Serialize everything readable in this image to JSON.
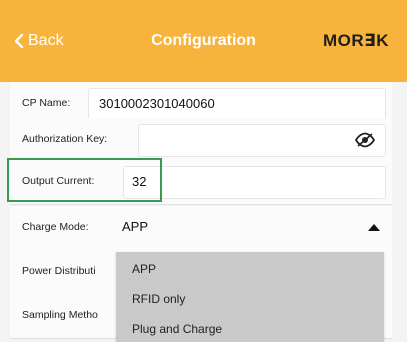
{
  "header": {
    "back_label": "Back",
    "title": "Configuration",
    "logo_text": "MOR∃K",
    "background_color": "#f7b33c"
  },
  "fields": {
    "cp_name": {
      "label": "CP Name:",
      "value": "3010002301040060"
    },
    "authorization_key": {
      "label": "Authorization Key:",
      "value": "",
      "icon": "eye-hidden-icon"
    },
    "output_current": {
      "label": "Output Current:",
      "value": "32"
    },
    "charge_mode": {
      "label": "Charge Mode:",
      "value": "APP",
      "icon": "caret-up-icon"
    },
    "power_distribution": {
      "label": "Power Distributi"
    },
    "sampling_method": {
      "label": "Sampling Metho"
    }
  },
  "charge_mode_options": [
    "APP",
    "RFID only",
    "Plug and Charge"
  ],
  "highlight_color": "#3b9a4f"
}
